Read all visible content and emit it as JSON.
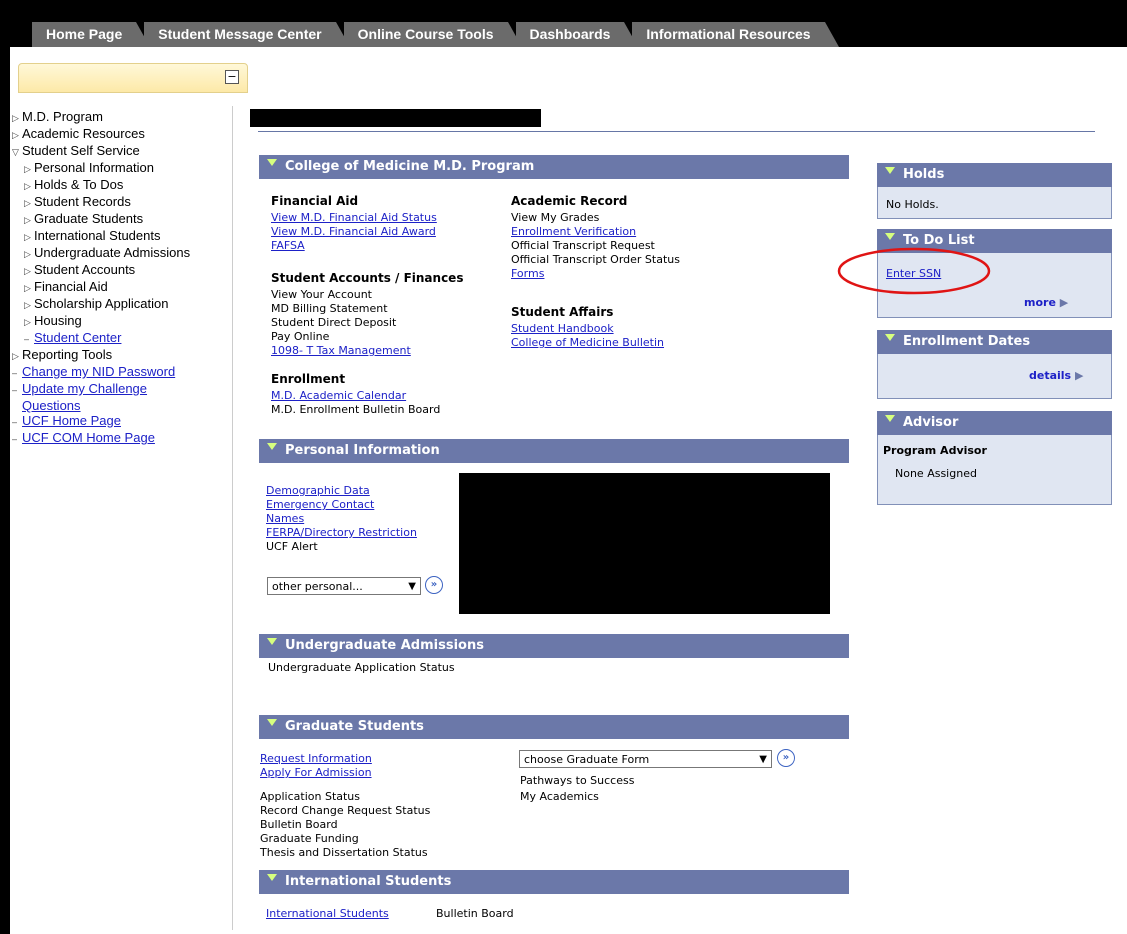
{
  "tabs": [
    "Home Page",
    "Student Message Center",
    "Online Course Tools",
    "Dashboards",
    "Informational Resources"
  ],
  "menu_collapse_icon": "minus-icon",
  "nav": {
    "items": [
      {
        "label": "M.D. Program",
        "level": 0,
        "kind": "folder"
      },
      {
        "label": "Academic Resources",
        "level": 0,
        "kind": "folder"
      },
      {
        "label": "Student Self Service",
        "level": 0,
        "kind": "open"
      },
      {
        "label": "Personal Information",
        "level": 1,
        "kind": "folder"
      },
      {
        "label": "Holds & To Dos",
        "level": 1,
        "kind": "folder"
      },
      {
        "label": "Student Records",
        "level": 1,
        "kind": "folder"
      },
      {
        "label": "Graduate Students",
        "level": 1,
        "kind": "folder"
      },
      {
        "label": "International Students",
        "level": 1,
        "kind": "folder"
      },
      {
        "label": "Undergraduate Admissions",
        "level": 1,
        "kind": "folder"
      },
      {
        "label": "Student Accounts",
        "level": 1,
        "kind": "folder"
      },
      {
        "label": "Financial Aid",
        "level": 1,
        "kind": "folder"
      },
      {
        "label": "Scholarship Application",
        "level": 1,
        "kind": "folder"
      },
      {
        "label": "Housing",
        "level": 1,
        "kind": "folder"
      },
      {
        "label": "Student Center",
        "level": 1,
        "kind": "link"
      },
      {
        "label": "Reporting Tools",
        "level": 0,
        "kind": "folder"
      },
      {
        "label": "Change my NID Password",
        "level": 0,
        "kind": "link"
      },
      {
        "label": "Update my Challenge",
        "level": 0,
        "kind": "link"
      },
      {
        "label": "Questions",
        "level": 0,
        "kind": "link-cont"
      },
      {
        "label": "UCF Home Page",
        "level": 0,
        "kind": "link"
      },
      {
        "label": "UCF COM Home Page",
        "level": 0,
        "kind": "link"
      }
    ]
  },
  "md": {
    "title": "College of Medicine M.D. Program",
    "financial_aid": {
      "heading": "Financial Aid",
      "links": [
        "View M.D. Financial Aid Status",
        "View M.D. Financial Aid Award",
        "FAFSA"
      ]
    },
    "accounts": {
      "heading": "Student Accounts / Finances",
      "items": [
        "View Your Account",
        "MD Billing Statement",
        "Student Direct Deposit",
        "Pay Online",
        "1098- T Tax Management"
      ]
    },
    "enrollment": {
      "heading": "Enrollment",
      "items": [
        "M.D. Academic Calendar",
        "M.D. Enrollment Bulletin Board"
      ]
    },
    "academic": {
      "heading": "Academic Record",
      "items": [
        "View My Grades",
        "Enrollment Verification",
        "Official Transcript Request",
        "Official Transcript Order Status",
        "Forms"
      ]
    },
    "affairs": {
      "heading": "Student Affairs",
      "links": [
        "Student Handbook",
        "College of Medicine Bulletin"
      ]
    }
  },
  "personal": {
    "title": "Personal Information",
    "links": [
      "Demographic Data",
      "Emergency Contact",
      "Names",
      "FERPA/Directory Restriction"
    ],
    "static": "UCF Alert",
    "select": "other personal..."
  },
  "undergrad": {
    "title": "Undergraduate Admissions",
    "status": "Undergraduate Application Status"
  },
  "graduate": {
    "title": "Graduate Students",
    "links": [
      "Request Information",
      "Apply For Admission"
    ],
    "items": [
      "Application Status",
      "Record Change Request Status",
      "Bulletin Board",
      "Graduate Funding",
      "Thesis and Dissertation Status"
    ],
    "select": "choose Graduate Form",
    "right_items": [
      "Pathways to Success",
      "My Academics"
    ]
  },
  "international": {
    "title": "International Students",
    "link": "International Students",
    "item": "Bulletin Board"
  },
  "holds": {
    "title": "Holds",
    "text": "No Holds."
  },
  "todo": {
    "title": "To Do List",
    "link": "Enter SSN",
    "more": "more"
  },
  "enroll_dates": {
    "title": "Enrollment Dates",
    "details": "details"
  },
  "advisor": {
    "title": "Advisor",
    "label": "Program Advisor",
    "value": "None Assigned"
  },
  "colors": {
    "header": "#6b78a9",
    "link": "#1d21c7",
    "annotation": "#e01414"
  }
}
